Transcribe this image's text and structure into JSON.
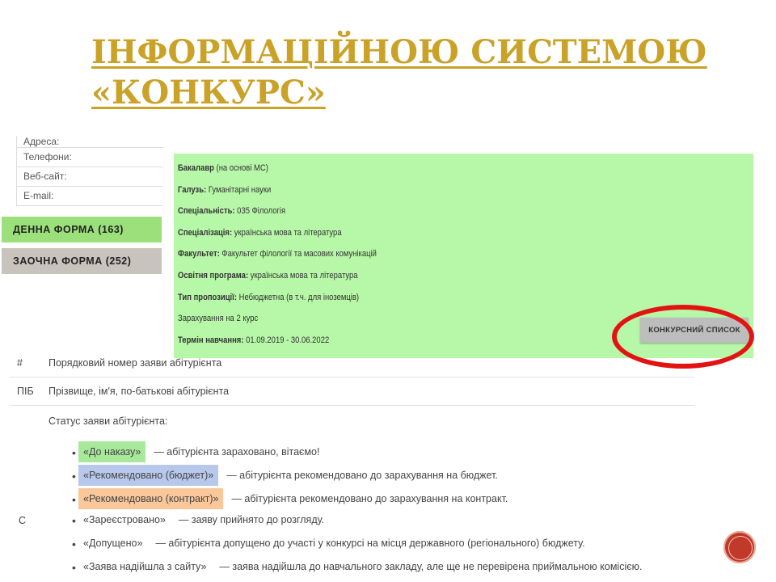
{
  "title": {
    "line1": "Інформаційною системою",
    "line2": "«Конкурс»"
  },
  "contacts": {
    "address": "Адреса:",
    "phones": "Телефони:",
    "website": "Веб-сайт:",
    "email": "E-mail:"
  },
  "forms": {
    "day": "ДЕННА ФОРМА (163)",
    "extramural": "ЗАОЧНА ФОРМА (252)"
  },
  "info": {
    "degree": "Бакалавр",
    "degree_note": "(на основі МС)",
    "field_label": "Галузь:",
    "field_value": "Гуманітарні науки",
    "specialty_label": "Спеціальність:",
    "specialty_value": "035 Філологія",
    "specialization_label": "Спеціалізація:",
    "specialization_value": "українська мова та література",
    "faculty_label": "Факультет:",
    "faculty_value": "Факультет філології та масових комунікацій",
    "program_label": "Освітня програма:",
    "program_value": "українська мова та література",
    "offer_type_label": "Тип пропозиції:",
    "offer_type_value": "Небюджетна (в т.ч. для іноземців)",
    "enrollment": "Зарахування на 2 курс",
    "term_label": "Термін навчання:",
    "term_value": "01.09.2019 - 30.06.2022",
    "button": "КОНКУРСНИЙ СПИСОК"
  },
  "legend": {
    "num_key": "#",
    "num_desc": "Порядковий номер заяви абітурієнта",
    "name_key": "ПІБ",
    "name_desc": "Прізвище, ім'я, по-батькові абітурієнта",
    "status_head": "Статус заяви абітурієнта:",
    "status_key": "С",
    "items": [
      {
        "tag": "«До наказу»",
        "text": "— абітурієнта зараховано, вітаємо!",
        "color": "#a8e89a"
      },
      {
        "tag": "«Рекомендовано (бюджет)»",
        "text": "— абітурієнта рекомендовано до зарахування на бюджет.",
        "color": "#b8c8ec"
      },
      {
        "tag": "«Рекомендовано (контракт)»",
        "text": "— абітурієнта рекомендовано до зарахування на контракт.",
        "color": "#f9c79a"
      },
      {
        "tag": "«Зареєстровано»",
        "text": "— заяву прийнято до розгляду.",
        "color": ""
      },
      {
        "tag": "«Допущено»",
        "text": "— абітурієнта допущено до участі у конкурсі на місця державного (регіонального) бюджету.",
        "color": ""
      },
      {
        "tag": "«Заява надійшла з сайту»",
        "text": "— заява надійшла до навчального закладу, але ще не перевірена приймальною комісією.",
        "color": ""
      }
    ]
  },
  "colors": {
    "title": "#c9a227",
    "panel_green": "#b7f7a8",
    "day_form": "#9be07a",
    "extramural_form": "#c9c3bd",
    "highlight_ring": "#e31313"
  }
}
